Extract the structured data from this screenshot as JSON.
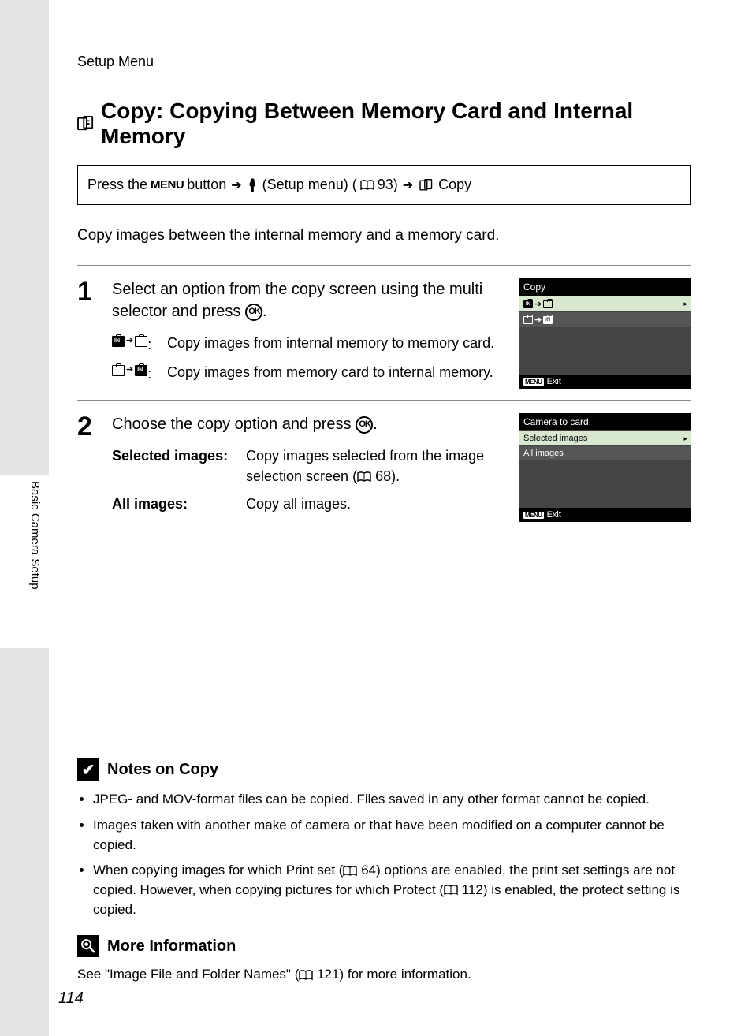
{
  "breadcrumb": "Setup Menu",
  "side_label": "Basic Camera Setup",
  "page_number": "114",
  "title": "Copy: Copying Between Memory Card and Internal Memory",
  "nav": {
    "press_the": "Press the",
    "menu_label": "MENU",
    "button": "button",
    "setup_menu": "(Setup menu) (",
    "page93": "93)",
    "copy_label": "Copy"
  },
  "intro": "Copy images between the internal memory and a memory card.",
  "step1": {
    "num": "1",
    "title_a": "Select an option from the copy screen using the multi selector and press ",
    "title_b": ".",
    "opt1_desc": "Copy images from internal memory to memory card.",
    "opt2_desc": "Copy images from memory card to internal memory."
  },
  "step2": {
    "num": "2",
    "title_a": "Choose the copy option and press ",
    "title_b": ".",
    "row1_label": "Selected images",
    "row1_desc_a": "Copy images selected from the image selection screen (",
    "row1_desc_b": "68).",
    "row2_label": "All images",
    "row2_desc": "Copy all images."
  },
  "screen1": {
    "title": "Copy",
    "exit": "Exit",
    "menu": "MENU"
  },
  "screen2": {
    "title": "Camera to card",
    "row1": "Selected images",
    "row2": "All images",
    "exit": "Exit",
    "menu": "MENU"
  },
  "notes": {
    "heading": "Notes on Copy",
    "items": [
      "JPEG- and MOV-format files can be copied. Files saved in any other format cannot be copied.",
      "Images taken with another make of camera or that have been modified on a computer cannot be copied."
    ],
    "item3_a": "When copying images for which Print set (",
    "item3_b": "64) options are enabled, the print set settings are not copied. However, when copying pictures for which Protect (",
    "item3_c": "112) is enabled, the protect setting is copied."
  },
  "moreinfo": {
    "heading": "More Information",
    "text_a": "See \"Image File and Folder Names\" (",
    "text_b": "121) for more information."
  }
}
